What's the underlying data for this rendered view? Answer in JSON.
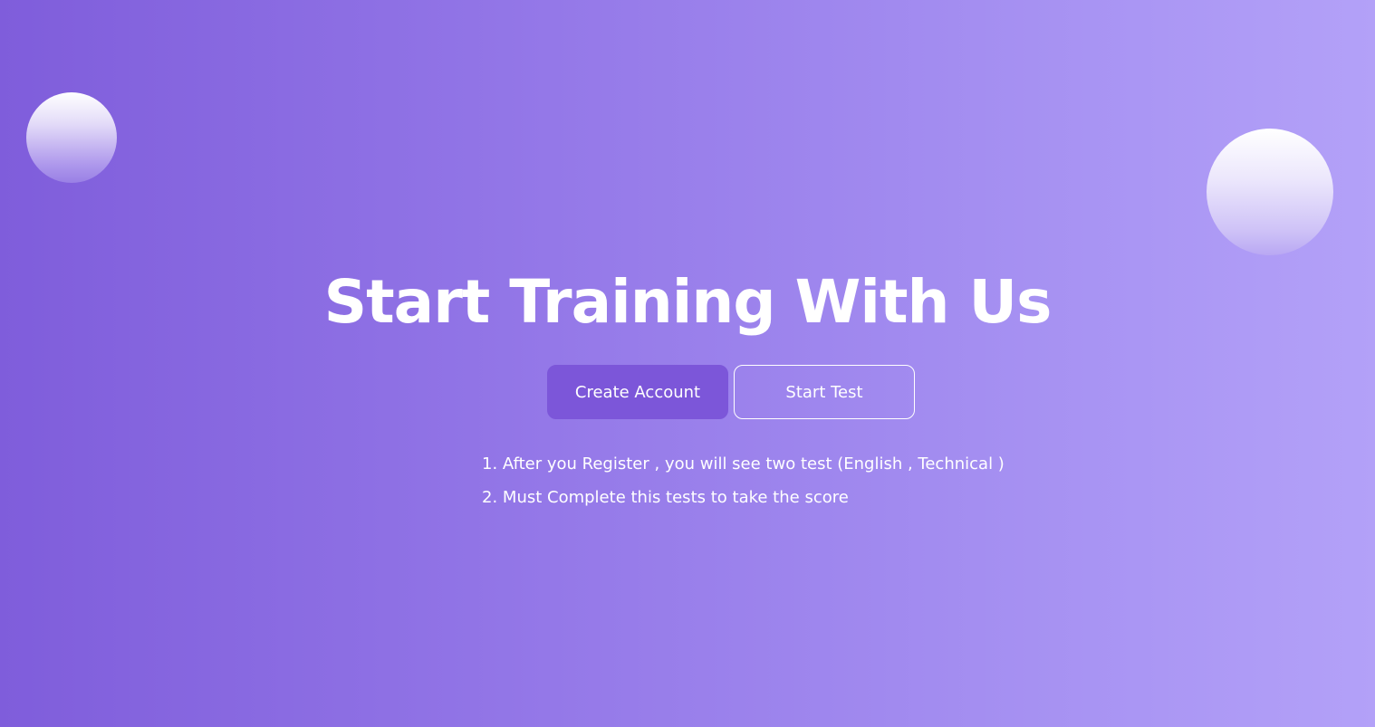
{
  "hero": {
    "title": "Start Training With Us"
  },
  "actions": {
    "create_account_label": "Create Account",
    "start_test_label": "Start Test"
  },
  "instructions": [
    {
      "number": "1.",
      "text": "After you Register , you will see two test (English , Technical )"
    },
    {
      "number": "2.",
      "text": "Must Complete this tests to take the score"
    }
  ],
  "colors": {
    "background_start": "#7f5ddb",
    "background_end": "#b3a1f8",
    "primary_button": "#7c56d9",
    "text": "#ffffff"
  }
}
